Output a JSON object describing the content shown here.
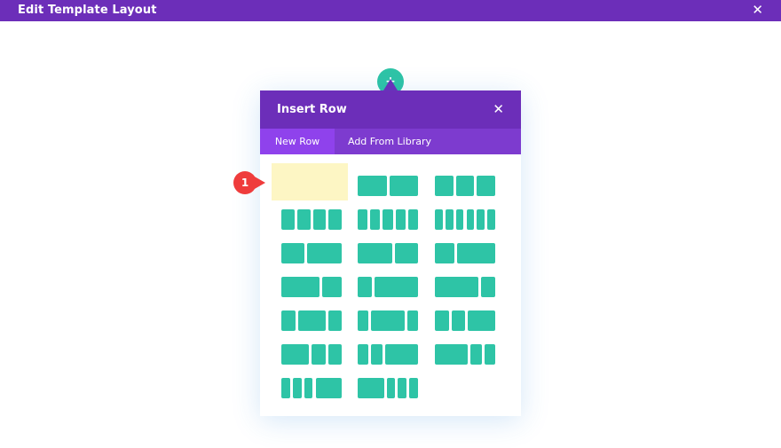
{
  "topbar": {
    "title": "Edit Template Layout",
    "close": "✕"
  },
  "add_button": {
    "label": "+"
  },
  "modal": {
    "title": "Insert Row",
    "close": "✕",
    "tabs": [
      {
        "label": "New Row",
        "active": true
      },
      {
        "label": "Add From Library",
        "active": false
      }
    ]
  },
  "callout": {
    "number": "1"
  },
  "colors": {
    "purple": "#6c2eb9",
    "teal": "#2ec4a6",
    "highlight": "#fdf6c4",
    "badge": "#ef3c3c"
  },
  "layouts": [
    {
      "name": "1 column",
      "cols": [
        1
      ]
    },
    {
      "name": "1/2 + 1/2",
      "cols": [
        1,
        1
      ]
    },
    {
      "name": "1/3 + 1/3 + 1/3",
      "cols": [
        1,
        1,
        1
      ]
    },
    {
      "name": "4 columns",
      "cols": [
        1,
        1,
        1,
        1
      ]
    },
    {
      "name": "5 columns",
      "cols": [
        1,
        1,
        1,
        1,
        1
      ]
    },
    {
      "name": "6 columns",
      "cols": [
        1,
        1,
        1,
        1,
        1,
        1
      ]
    },
    {
      "name": "2/5 + 3/5",
      "cols": [
        2,
        3
      ]
    },
    {
      "name": "3/5 + 2/5",
      "cols": [
        3,
        2
      ]
    },
    {
      "name": "1/3 + 2/3",
      "cols": [
        1,
        2
      ]
    },
    {
      "name": "2/3 + 1/3",
      "cols": [
        2,
        1
      ]
    },
    {
      "name": "1/4 + 3/4",
      "cols": [
        1,
        3
      ]
    },
    {
      "name": "3/4 + 1/4",
      "cols": [
        3,
        1
      ]
    },
    {
      "name": "1/4 + 1/2 + 1/4",
      "cols": [
        1,
        2,
        1
      ]
    },
    {
      "name": "1/5 + 3/5 + 1/5",
      "cols": [
        1,
        3,
        1
      ]
    },
    {
      "name": "1/4 + 1/4 + 1/2",
      "cols": [
        1,
        1,
        2
      ]
    },
    {
      "name": "1/2 + 1/4 + 1/4",
      "cols": [
        2,
        1,
        1
      ]
    },
    {
      "name": "1/5 + 1/5 + 3/5",
      "cols": [
        1,
        1,
        3
      ]
    },
    {
      "name": "3/5 + 1/5 + 1/5",
      "cols": [
        3,
        1,
        1
      ]
    },
    {
      "name": "1/6 + 1/6 + 1/6 + 1/2",
      "cols": [
        1,
        1,
        1,
        3
      ]
    },
    {
      "name": "1/2 + 1/6 + 1/6 + 1/6",
      "cols": [
        3,
        1,
        1,
        1
      ]
    }
  ]
}
